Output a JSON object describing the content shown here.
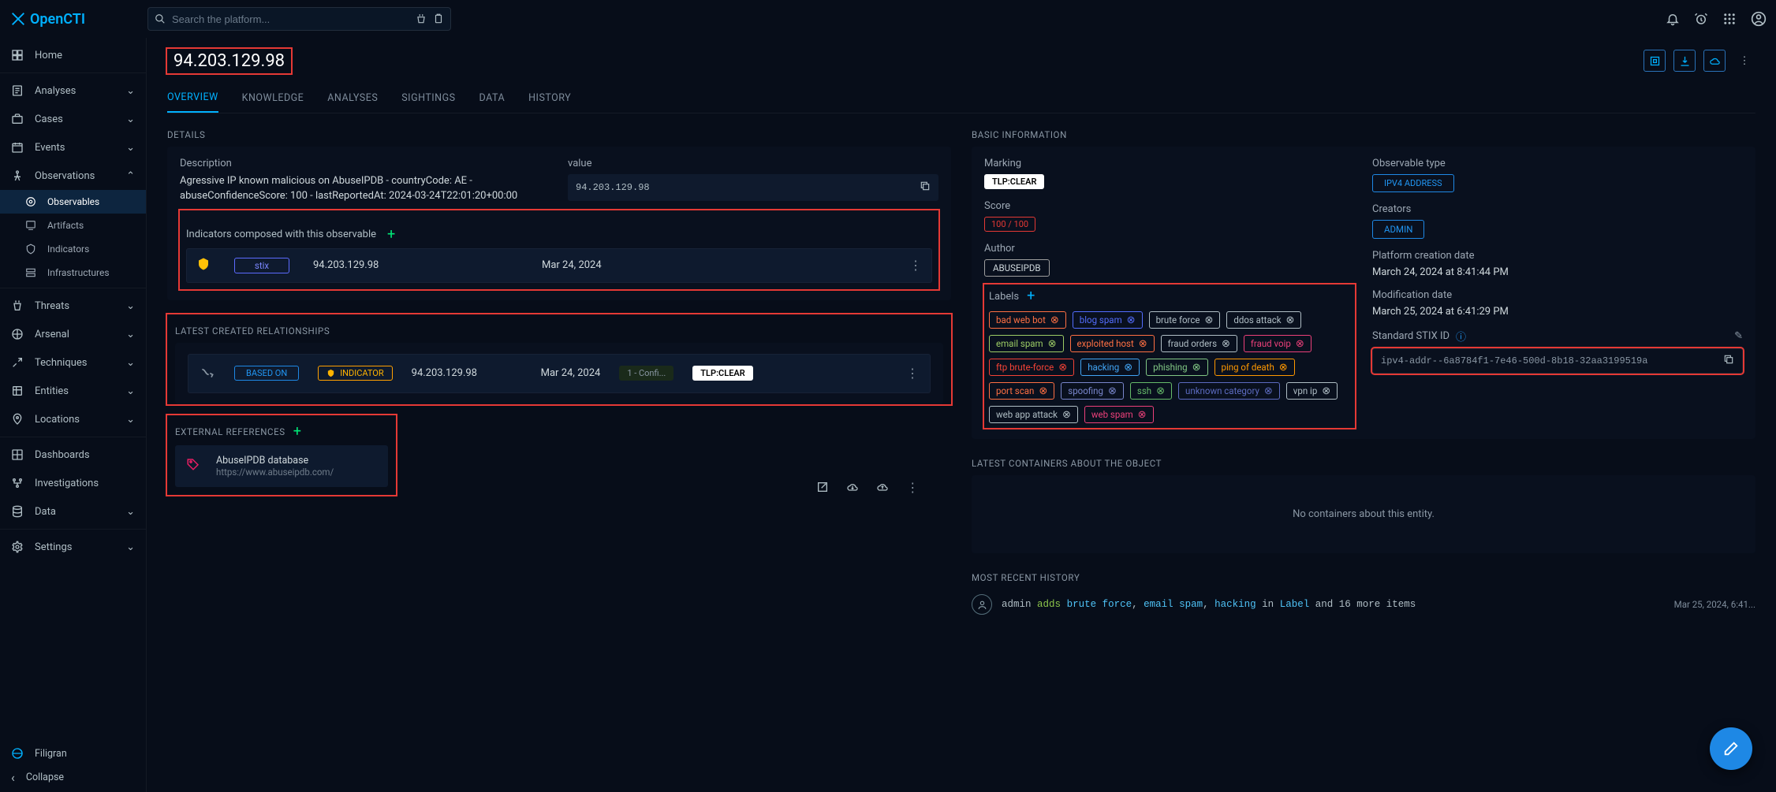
{
  "search": {
    "placeholder": "Search the platform..."
  },
  "app_name": "OpenCTI",
  "sidebar": {
    "home": "Home",
    "analyses": "Analyses",
    "cases": "Cases",
    "events": "Events",
    "observations": "Observations",
    "observables": "Observables",
    "artifacts": "Artifacts",
    "indicators": "Indicators",
    "infrastructures": "Infrastructures",
    "threats": "Threats",
    "arsenal": "Arsenal",
    "techniques": "Techniques",
    "entities": "Entities",
    "locations": "Locations",
    "dashboards": "Dashboards",
    "investigations": "Investigations",
    "data": "Data",
    "settings": "Settings",
    "filigran": "Filigran",
    "collapse": "Collapse"
  },
  "title": "94.203.129.98",
  "tabs": [
    "OVERVIEW",
    "KNOWLEDGE",
    "ANALYSES",
    "SIGHTINGS",
    "DATA",
    "HISTORY"
  ],
  "details": {
    "h": "DETAILS",
    "desc_label": "Description",
    "desc": "Agressive IP known malicious on AbuseIPDB - countryCode: AE - abuseConfidenceScore: 100 - lastReportedAt: 2024-03-24T22:01:20+00:00",
    "value_label": "value",
    "value": "94.203.129.98",
    "indicators_h": "Indicators composed with this observable",
    "row": {
      "pattern": "stix",
      "name": "94.203.129.98",
      "date": "Mar 24, 2024"
    }
  },
  "basic": {
    "h": "BASIC INFORMATION",
    "marking_l": "Marking",
    "marking": "TLP:CLEAR",
    "obs_type_l": "Observable type",
    "obs_type": "IPV4 ADDRESS",
    "score_l": "Score",
    "score": "100 / 100",
    "creators_l": "Creators",
    "creators": "ADMIN",
    "author_l": "Author",
    "author": "ABUSEIPDB",
    "pcd_l": "Platform creation date",
    "pcd": "March 24, 2024 at 8:41:44 PM",
    "mod_l": "Modification date",
    "mod": "March 25, 2024 at 6:41:29 PM",
    "stix_l": "Standard STIX ID",
    "stix": "ipv4-addr--6a8784f1-7e46-500d-8b18-32aa3199519a",
    "labels_l": "Labels"
  },
  "labels": [
    {
      "t": "bad web bot",
      "c": "#ff7043"
    },
    {
      "t": "blog spam",
      "c": "#536dfe"
    },
    {
      "t": "brute force",
      "c": "#b0bec5"
    },
    {
      "t": "ddos attack",
      "c": "#b0bec5"
    },
    {
      "t": "email spam",
      "c": "#9ccc65"
    },
    {
      "t": "exploited host",
      "c": "#ff7043"
    },
    {
      "t": "fraud orders",
      "c": "#b0bec5"
    },
    {
      "t": "fraud voip",
      "c": "#ec407a"
    },
    {
      "t": "ftp brute-force",
      "c": "#f44336"
    },
    {
      "t": "hacking",
      "c": "#42a5f5"
    },
    {
      "t": "phishing",
      "c": "#81c784"
    },
    {
      "t": "ping of death",
      "c": "#ff9800"
    },
    {
      "t": "port scan",
      "c": "#ff7043"
    },
    {
      "t": "spoofing",
      "c": "#7986cb"
    },
    {
      "t": "ssh",
      "c": "#66bb6a"
    },
    {
      "t": "unknown category",
      "c": "#5c6bc0"
    },
    {
      "t": "vpn ip",
      "c": "#b0bec5"
    },
    {
      "t": "web app attack",
      "c": "#b0bec5"
    },
    {
      "t": "web spam",
      "c": "#ec407a"
    }
  ],
  "rel": {
    "h": "LATEST CREATED RELATIONSHIPS",
    "type": "BASED ON",
    "ind": "INDICATOR",
    "name": "94.203.129.98",
    "date": "Mar 24, 2024",
    "conf": "1 - Confi...",
    "tlp": "TLP:CLEAR"
  },
  "containers": {
    "h": "LATEST CONTAINERS ABOUT THE OBJECT",
    "empty": "No containers about this entity."
  },
  "ext": {
    "h": "EXTERNAL REFERENCES",
    "title": "AbuseIPDB database",
    "url": "https://www.abuseipdb.com/"
  },
  "hist": {
    "h": "MOST RECENT HISTORY",
    "r1_pre": "admin",
    "r1_v": "adds",
    "r1_a": "brute force",
    "r1_b": "email spam",
    "r1_c": "hacking",
    "r1_mid": "in",
    "r1_lbl": "Label",
    "r1_post": "and 16 more items",
    "r1_date": "Mar 25, 2024, 6:41..."
  }
}
